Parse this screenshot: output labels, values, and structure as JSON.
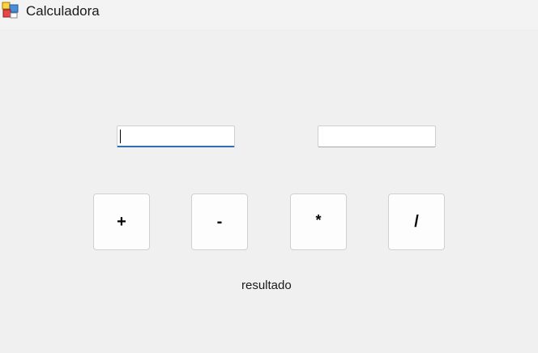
{
  "window": {
    "title": "Calculadora",
    "icon": "winforms-app-icon"
  },
  "inputs": {
    "first_value": "",
    "second_value": ""
  },
  "buttons": {
    "add": "+",
    "subtract": "-",
    "multiply": "*",
    "divide": "/"
  },
  "result": {
    "label": "resultado"
  },
  "colors": {
    "background": "#f0f0f0",
    "focus_accent": "#2f6fb3"
  }
}
